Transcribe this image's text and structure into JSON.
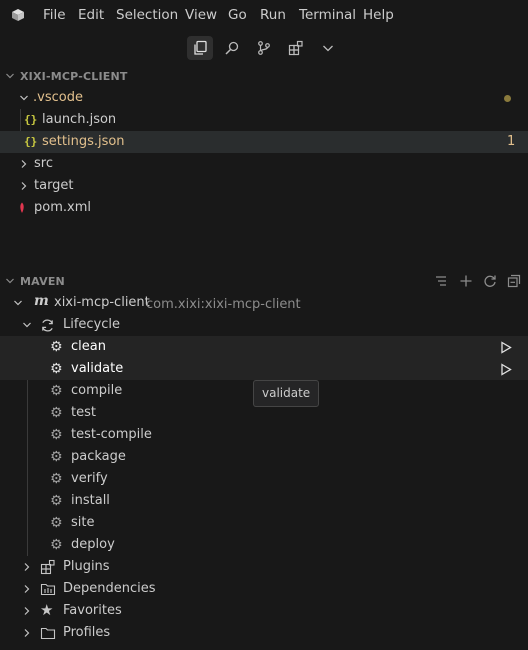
{
  "menu": {
    "items": [
      "File",
      "Edit",
      "Selection",
      "View",
      "Go",
      "Run",
      "Terminal",
      "Help"
    ]
  },
  "explorer": {
    "title": "XIXI-MCP-CLIENT",
    "vscode_folder": ".vscode",
    "launch_file": "launch.json",
    "settings_file": "settings.json",
    "settings_badge": "1",
    "src_folder": "src",
    "target_folder": "target",
    "pom_file": "pom.xml"
  },
  "maven": {
    "title": "MAVEN",
    "project_name": "xixi-mcp-client",
    "project_coords": "com.xixi:xixi-mcp-client",
    "lifecycle_label": "Lifecycle",
    "phases": [
      "clean",
      "validate",
      "compile",
      "test",
      "test-compile",
      "package",
      "verify",
      "install",
      "site",
      "deploy"
    ],
    "groups": [
      "Plugins",
      "Dependencies",
      "Favorites",
      "Profiles"
    ]
  },
  "tooltip": {
    "text": "validate"
  },
  "colors": {
    "background": "#181818",
    "selection": "#2a2d2e",
    "folder_text": "#e2c08d",
    "json_icon": "#cbcb41",
    "maven_icon": "#e37933"
  }
}
